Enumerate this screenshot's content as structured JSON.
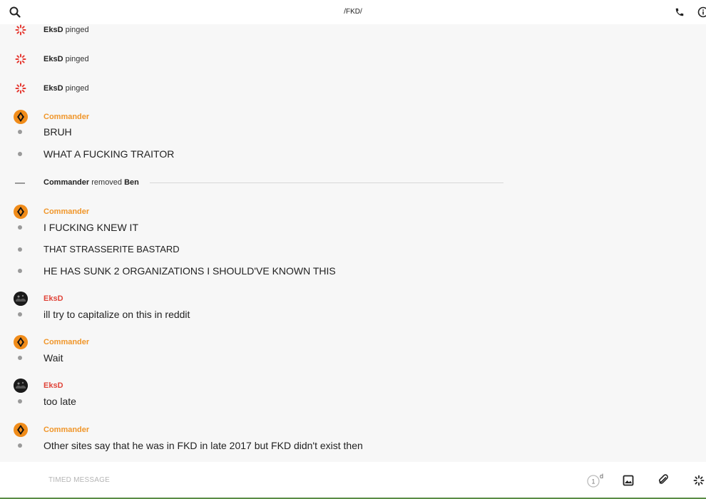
{
  "header": {
    "title": "/FKD/"
  },
  "colors": {
    "commander": "#f0962a",
    "eksd": "#e0453a",
    "ping": "#e53a32"
  },
  "feed": {
    "pings": [
      {
        "user": "EksD",
        "action": "pinged"
      },
      {
        "user": "EksD",
        "action": "pinged"
      },
      {
        "user": "EksD",
        "action": "pinged"
      }
    ],
    "group1": {
      "author": "Commander",
      "messages": [
        "BRUH",
        "WHAT A FUCKING TRAITOR"
      ]
    },
    "removal": {
      "actor": "Commander",
      "action": "removed",
      "target": "Ben"
    },
    "group2": {
      "author": "Commander",
      "messages": [
        "I FUCKING KNEW IT",
        "THAT STRASSERITE BASTARD",
        "HE HAS SUNK 2 ORGANIZATIONS I SHOULD'VE KNOWN THIS"
      ]
    },
    "group3": {
      "author": "EksD",
      "messages": [
        "ill try to capitalize on this in reddit"
      ]
    },
    "group4": {
      "author": "Commander",
      "messages": [
        "Wait"
      ]
    },
    "group5": {
      "author": "EksD",
      "messages": [
        "too late"
      ]
    },
    "group6": {
      "author": "Commander",
      "messages": [
        "Other sites say that he was in FKD in late 2017 but FKD didn't exist then"
      ]
    }
  },
  "composer": {
    "placeholder": "TIMED MESSAGE",
    "timer_value": "1",
    "timer_unit": "d"
  },
  "icons": {
    "search": "search-icon",
    "call": "phone-icon",
    "info": "info-icon",
    "ping": "ping-icon",
    "timer": "timer-icon",
    "image": "image-icon",
    "attach": "paperclip-icon"
  }
}
